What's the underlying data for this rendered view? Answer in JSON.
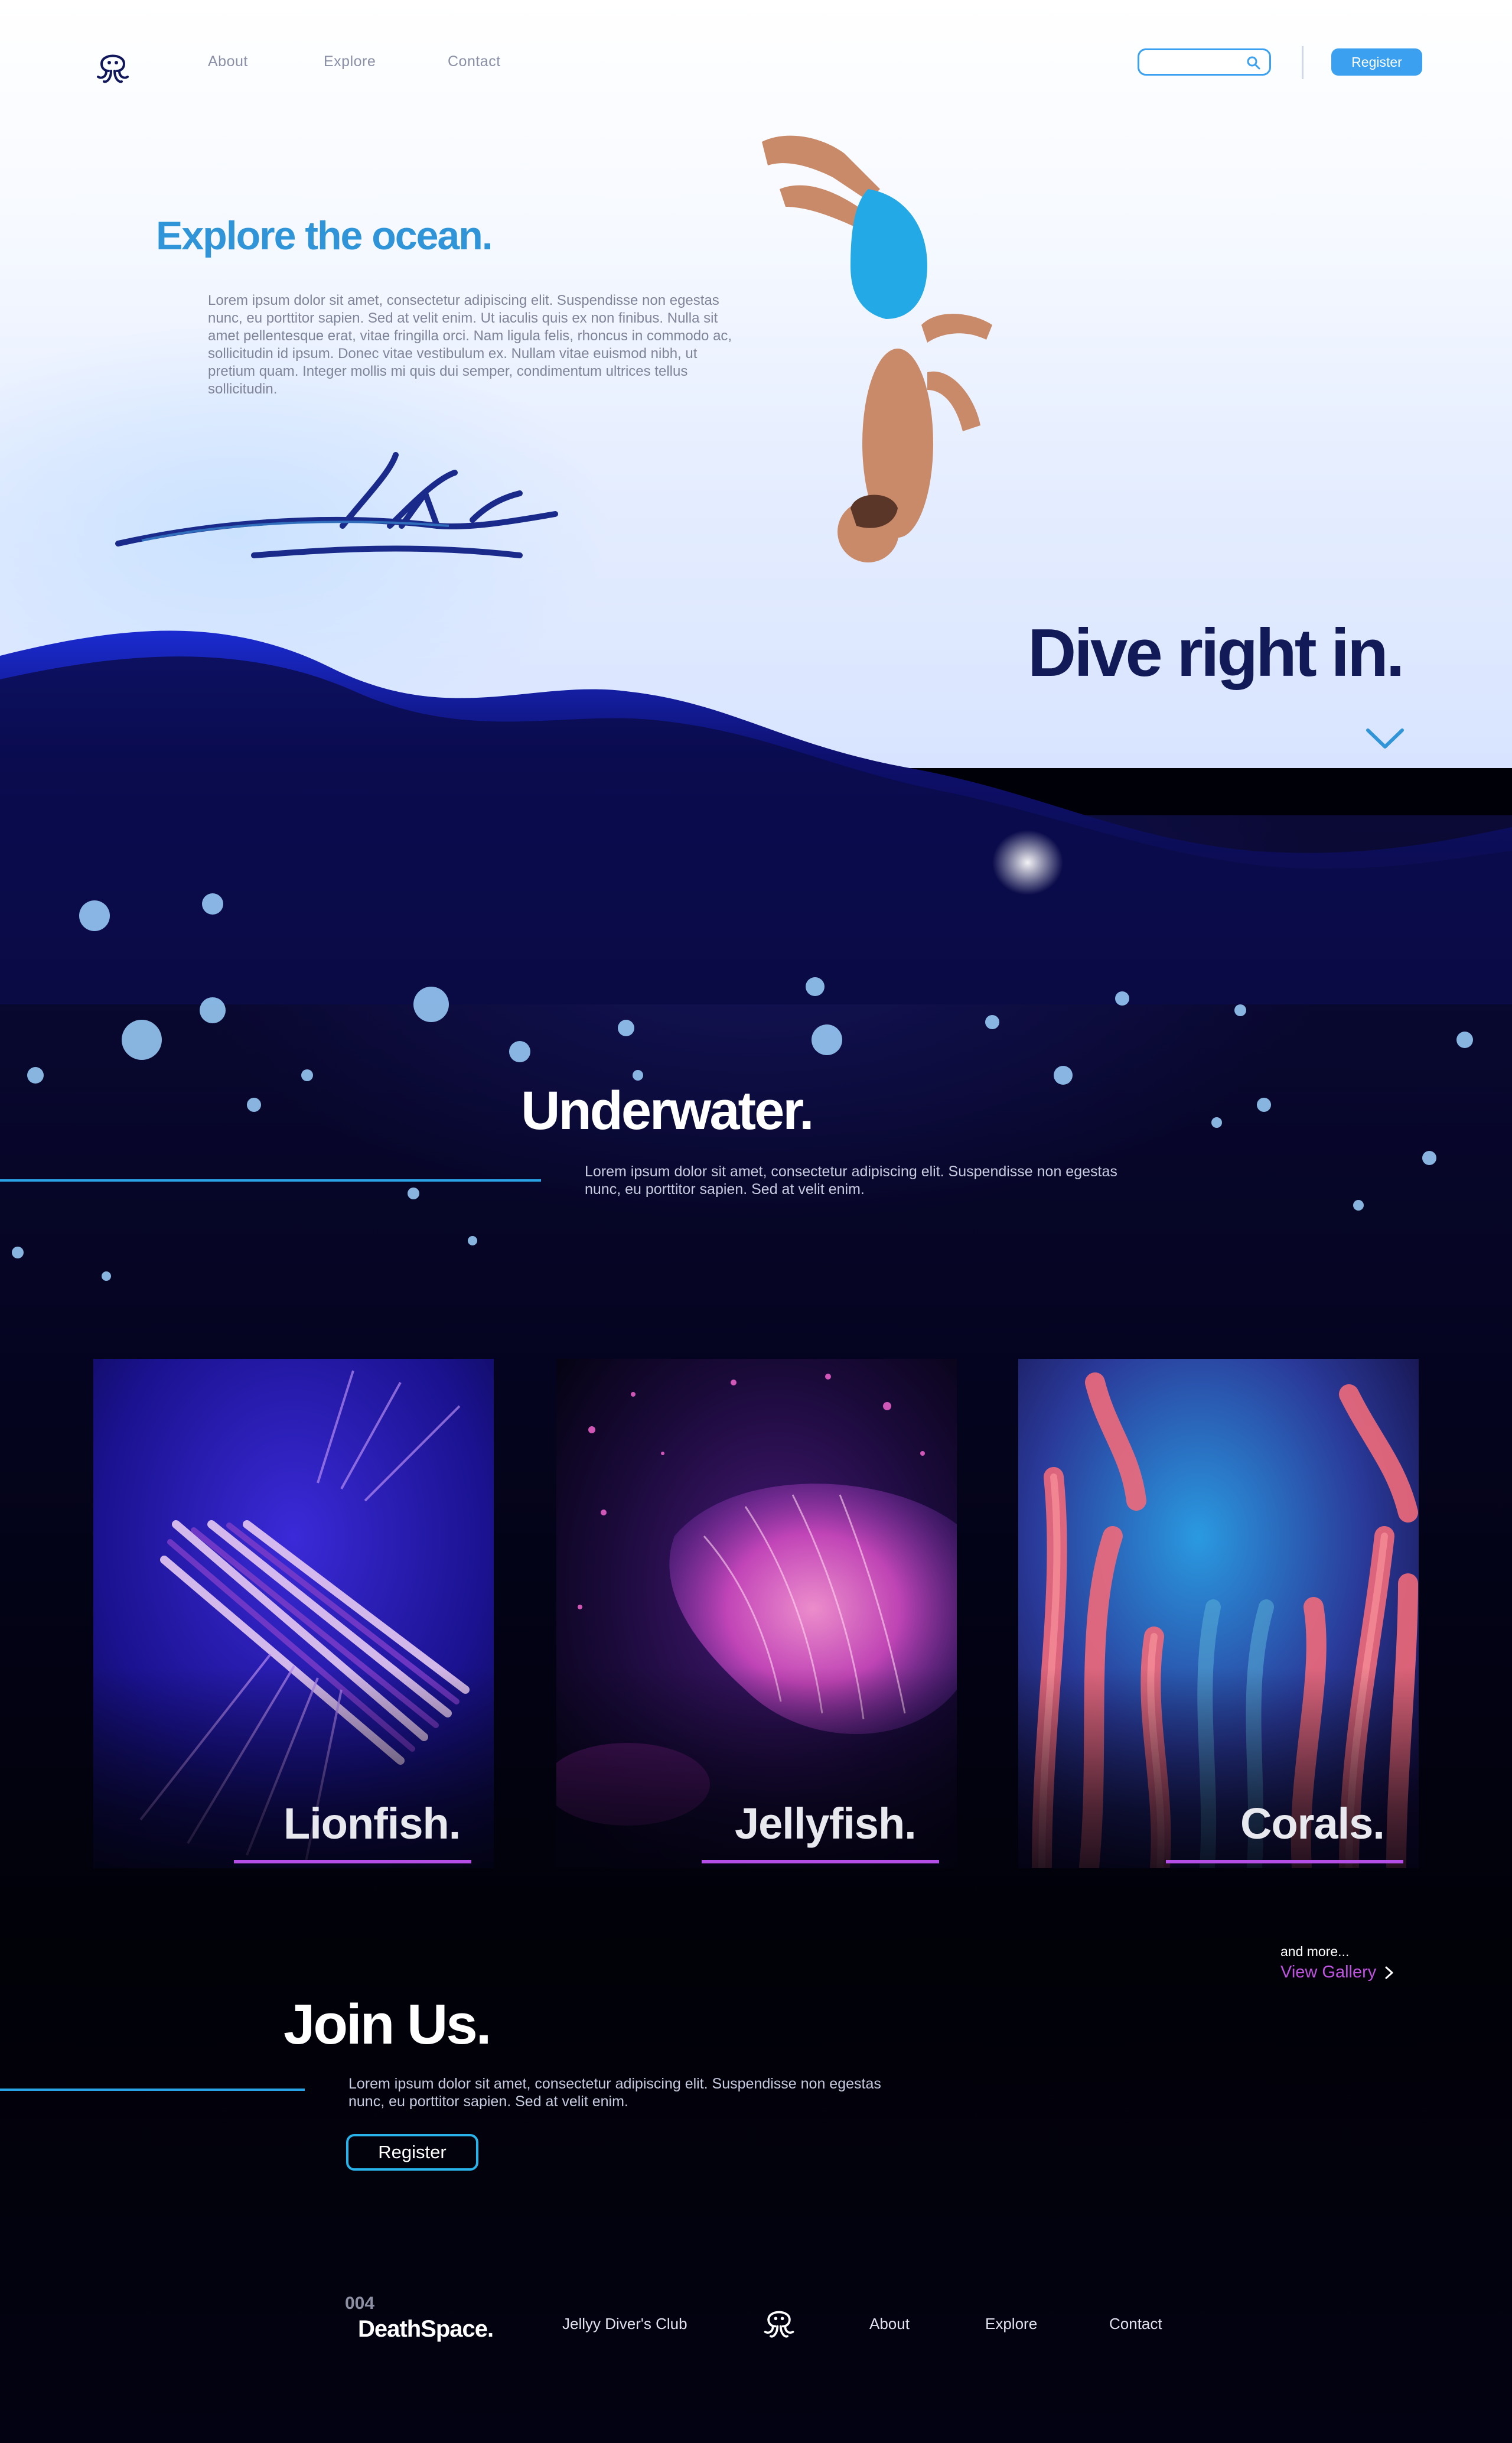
{
  "header": {
    "nav": [
      "About",
      "Explore",
      "Contact"
    ],
    "search_placeholder": "",
    "register_label": "Register"
  },
  "hero": {
    "title": "Explore the ocean.",
    "text": "Lorem ipsum dolor sit amet, consectetur adipiscing elit. Suspendisse non egestas nunc, eu porttitor sapien. Sed at velit enim. Ut iaculis quis ex non finibus. Nulla sit amet pellentesque erat, vitae fringilla orci. Nam ligula felis, rhoncus in commodo ac, sollicitudin id ipsum.  Donec vitae vestibulum ex. Nullam vitae euismod nibh, ut pretium quam. Integer mollis mi quis dui semper, condimentum ultrices tellus sollicitudin.",
    "dive_title": "Dive right in."
  },
  "underwater": {
    "title": "Underwater.",
    "text": "Lorem ipsum dolor sit amet, consectetur adipiscing elit. Suspendisse non egestas nunc, eu porttitor sapien. Sed at velit enim."
  },
  "cards": [
    {
      "label": "Lionfish."
    },
    {
      "label": "Jellyfish."
    },
    {
      "label": "Corals."
    }
  ],
  "gallery": {
    "and_more": "and more...",
    "view_gallery": "View Gallery"
  },
  "join": {
    "title": "Join Us.",
    "text": "Lorem ipsum dolor sit amet, consectetur adipiscing elit. Suspendisse non egestas nunc, eu porttitor sapien. Sed at velit enim.",
    "register_label": "Register"
  },
  "footer": {
    "number": "004",
    "brand": "DeathSpace.",
    "club": "Jellyy Diver's Club",
    "nav": [
      "About",
      "Explore",
      "Contact"
    ]
  },
  "colors": {
    "accent_blue": "#3aa0ef",
    "title_navy": "#121a58",
    "accent_purple": "#b54ee6"
  }
}
